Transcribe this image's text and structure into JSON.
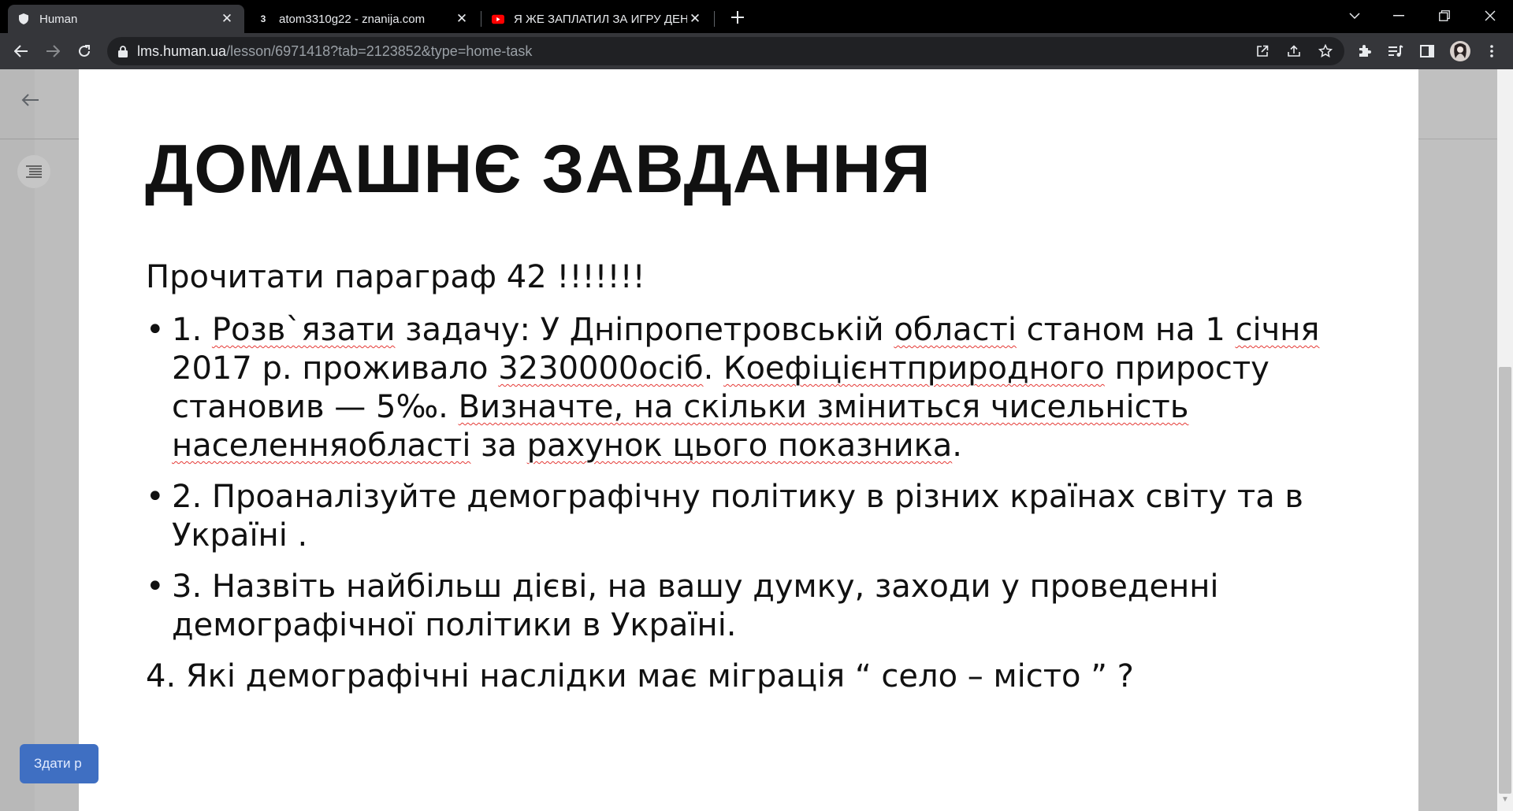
{
  "tabs": [
    {
      "title": "Human",
      "favicon": "human-shield-icon",
      "active": true
    },
    {
      "title": "atom3310g22 - znanija.com",
      "favicon": "znanija-3-icon",
      "active": false
    },
    {
      "title": "Я ЖЕ ЗАПЛАТИЛ ЗА ИГРУ ДЕНЬ",
      "favicon": "youtube-icon",
      "active": false
    }
  ],
  "address": {
    "host": "lms.human.ua",
    "path": "/lesson/6971418?tab=2123852&type=home-task"
  },
  "page": {
    "submit_label": "Здати р",
    "slide": {
      "title": "ДОМАШНЄ ЗАВДАННЯ",
      "intro": "Прочитати параграф 42 !!!!!!!",
      "item1": {
        "p1": "1. ",
        "p2": "Розв`язати",
        "p3": " задачу: У Дніпропетровській ",
        "p4": "області",
        "p5": " станом на 1 ",
        "p6": "січня",
        "p7": " 2017 р. проживало ",
        "p8": "3230000осіб",
        "p9": ". ",
        "p10": "Коефіцієнтприродного",
        "p11": " приросту становив — 5‰. ",
        "p12": "Визначте, на скільки зміниться чисельність населенняобласті",
        "p13": " за ",
        "p14": "рахунок цього показника",
        "p15": "."
      },
      "item2": "2. Проаналізуйте демографічну політику в різних країнах світу та в Україні .",
      "item3": "3. Назвіть найбільш дієві, на вашу думку, заходи у проведенні демографічної політики в Україні.",
      "item4": "4. Які демографічні наслідки має міграція “ село – місто ” ?"
    }
  },
  "colors": {
    "tabstrip": "#000000",
    "toolbar": "#35363a",
    "accent_button": "#3f6fc2",
    "spell_underline": "#e53935"
  }
}
